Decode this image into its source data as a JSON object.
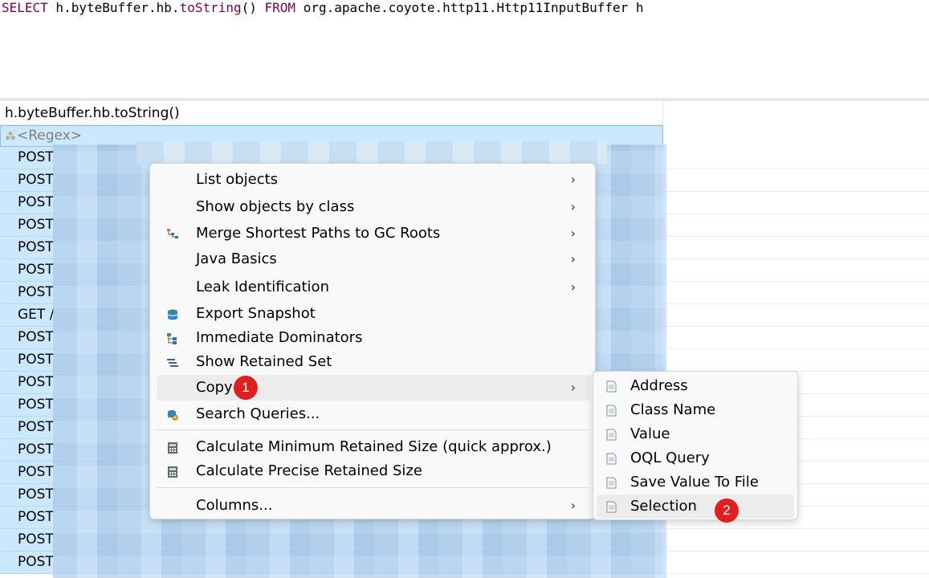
{
  "editor": {
    "query_parts": [
      {
        "text": "SELECT",
        "kind": "kw"
      },
      {
        "text": " h.byteBuffer.hb.",
        "kind": "txt"
      },
      {
        "text": "toString",
        "kind": "fn"
      },
      {
        "text": "() ",
        "kind": "txt"
      },
      {
        "text": "FROM",
        "kind": "kw"
      },
      {
        "text": " org.apache.coyote.http11.Http11InputBuffer h",
        "kind": "txt"
      }
    ]
  },
  "table": {
    "column_header": "h.byteBuffer.hb.toString()",
    "filter_placeholder": "<Regex>",
    "rows": [
      "POST",
      "POST",
      "POST",
      "POST",
      "POST",
      "POST",
      "POST",
      "GET /",
      "POST",
      "POST",
      "POST",
      "POST",
      "POST",
      "POST",
      "POST",
      "POST",
      "POST",
      "POST",
      "POST"
    ]
  },
  "context_menu": {
    "items": [
      {
        "label": "List objects",
        "submenu": true,
        "icon": ""
      },
      {
        "label": "Show objects by class",
        "submenu": true,
        "icon": ""
      },
      {
        "label": "Merge Shortest Paths to GC Roots",
        "submenu": true,
        "icon": "paths-icon"
      },
      {
        "label": "Java Basics",
        "submenu": true,
        "icon": ""
      },
      {
        "label": "Leak Identification",
        "submenu": true,
        "icon": ""
      },
      {
        "label": "Export Snapshot",
        "submenu": false,
        "icon": "database-icon"
      },
      {
        "label": "Immediate Dominators",
        "submenu": false,
        "icon": "tree-icon"
      },
      {
        "label": "Show Retained Set",
        "submenu": false,
        "icon": "list-icon"
      },
      {
        "label": "Copy",
        "submenu": true,
        "icon": ""
      },
      {
        "label": "Search Queries...",
        "submenu": false,
        "icon": "search-db-icon"
      },
      {
        "label": "Calculate Minimum Retained Size (quick approx.)",
        "submenu": false,
        "icon": "calculator-icon"
      },
      {
        "label": "Calculate Precise Retained Size",
        "submenu": false,
        "icon": "calculator-icon"
      },
      {
        "label": "Columns...",
        "submenu": true,
        "icon": ""
      }
    ],
    "chevron": "›"
  },
  "copy_submenu": {
    "items": [
      "Address",
      "Class Name",
      "Value",
      "OQL Query",
      "Save Value To File",
      "Selection"
    ],
    "icon": "document-icon"
  },
  "badges": [
    "1",
    "2"
  ],
  "colors": {
    "selection": "#cce8ff",
    "keyword": "#7f0055",
    "badge": "#e02020",
    "menu_bg": "#f9f9f9",
    "hover": "#ececec"
  }
}
